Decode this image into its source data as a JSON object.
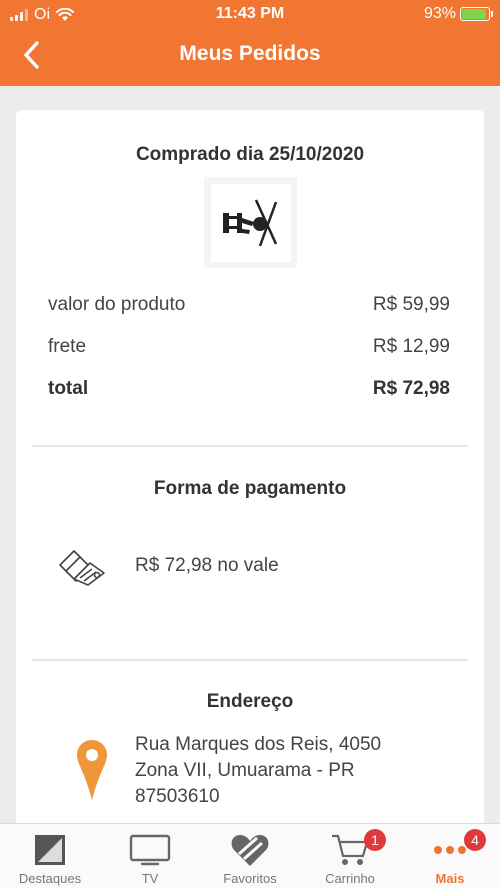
{
  "status_bar": {
    "carrier": "Oi",
    "time": "11:43 PM",
    "battery": "93%",
    "battery_level": 0.93
  },
  "header": {
    "title": "Meus Pedidos",
    "back_icon": "chevron-left-icon"
  },
  "order": {
    "purchase_date_label": "Comprado dia 25/10/2020",
    "product_icon": "tv-wall-mount-icon",
    "lines": [
      {
        "label": "valor do produto",
        "value": "R$ 59,99"
      },
      {
        "label": "frete",
        "value": "R$ 12,99"
      },
      {
        "label": "total",
        "value": "R$ 72,98"
      }
    ]
  },
  "payment": {
    "title": "Forma de pagamento",
    "icon": "voucher-icon",
    "text": "R$ 72,98 no vale"
  },
  "address": {
    "title": "Endereço",
    "icon": "location-pin-icon",
    "line1": "Rua Marques dos Reis, 4050",
    "line2": "Zona VII, Umuarama - PR",
    "line3": "87503610"
  },
  "tabs": [
    {
      "label": "Destaques",
      "icon": "featured-icon"
    },
    {
      "label": "TV",
      "icon": "tv-icon"
    },
    {
      "label": "Favoritos",
      "icon": "heart-icon"
    },
    {
      "label": "Carrinho",
      "icon": "cart-icon",
      "badge": "1"
    },
    {
      "label": "Mais",
      "icon": "more-icon",
      "badge": "4",
      "active": true
    }
  ],
  "colors": {
    "brand": "#f07632",
    "badge": "#e0393b",
    "pin": "#f0963a"
  }
}
